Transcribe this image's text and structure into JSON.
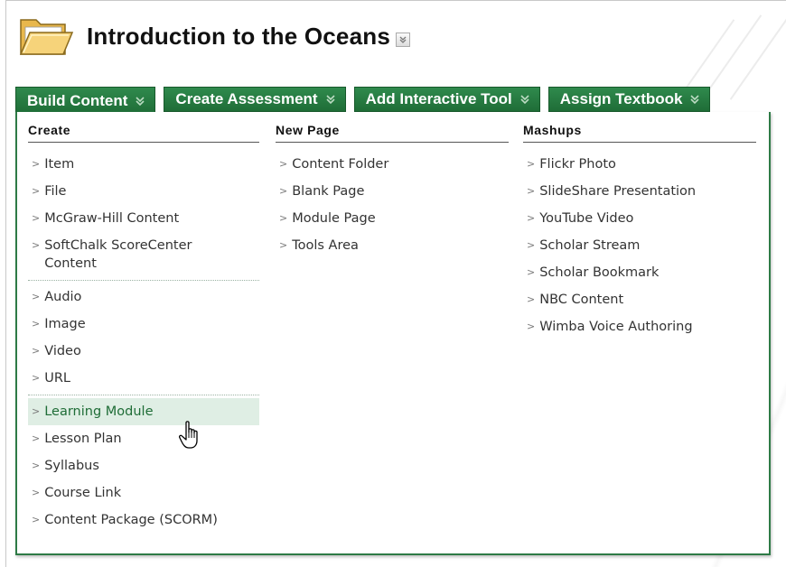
{
  "page": {
    "title": "Introduction to the Oceans"
  },
  "toolbar": {
    "build_content": "Build Content",
    "create_assessment": "Create Assessment",
    "add_interactive_tool": "Add Interactive Tool",
    "assign_textbook": "Assign Textbook"
  },
  "menu": {
    "create": {
      "heading": "Create",
      "group1": [
        "Item",
        "File",
        "McGraw-Hill Content",
        "SoftChalk ScoreCenter Content"
      ],
      "group2": [
        "Audio",
        "Image",
        "Video",
        "URL"
      ],
      "group3": [
        "Learning Module",
        "Lesson Plan",
        "Syllabus",
        "Course Link",
        "Content Package (SCORM)"
      ]
    },
    "new_page": {
      "heading": "New Page",
      "items": [
        "Content Folder",
        "Blank Page",
        "Module Page",
        "Tools Area"
      ]
    },
    "mashups": {
      "heading": "Mashups",
      "items": [
        "Flickr Photo",
        "SlideShare Presentation",
        "YouTube Video",
        "Scholar Stream",
        "Scholar Bookmark",
        "NBC Content",
        "Wimba Voice Authoring"
      ]
    },
    "hovered_item": "Learning Module"
  },
  "icons": {
    "page_icon": "folder-icon",
    "title_menu": "double-chevron-down-icon",
    "toolbar_chevron": "double-chevron-down-icon",
    "item_arrow": "chevron-right-icon",
    "cursor": "hand-pointer-icon"
  },
  "colors": {
    "toolbar_green": "#2f8a4d",
    "panel_border": "#2e7b46",
    "hover_bg": "#dfeee4",
    "hover_text": "#1f6d37"
  }
}
